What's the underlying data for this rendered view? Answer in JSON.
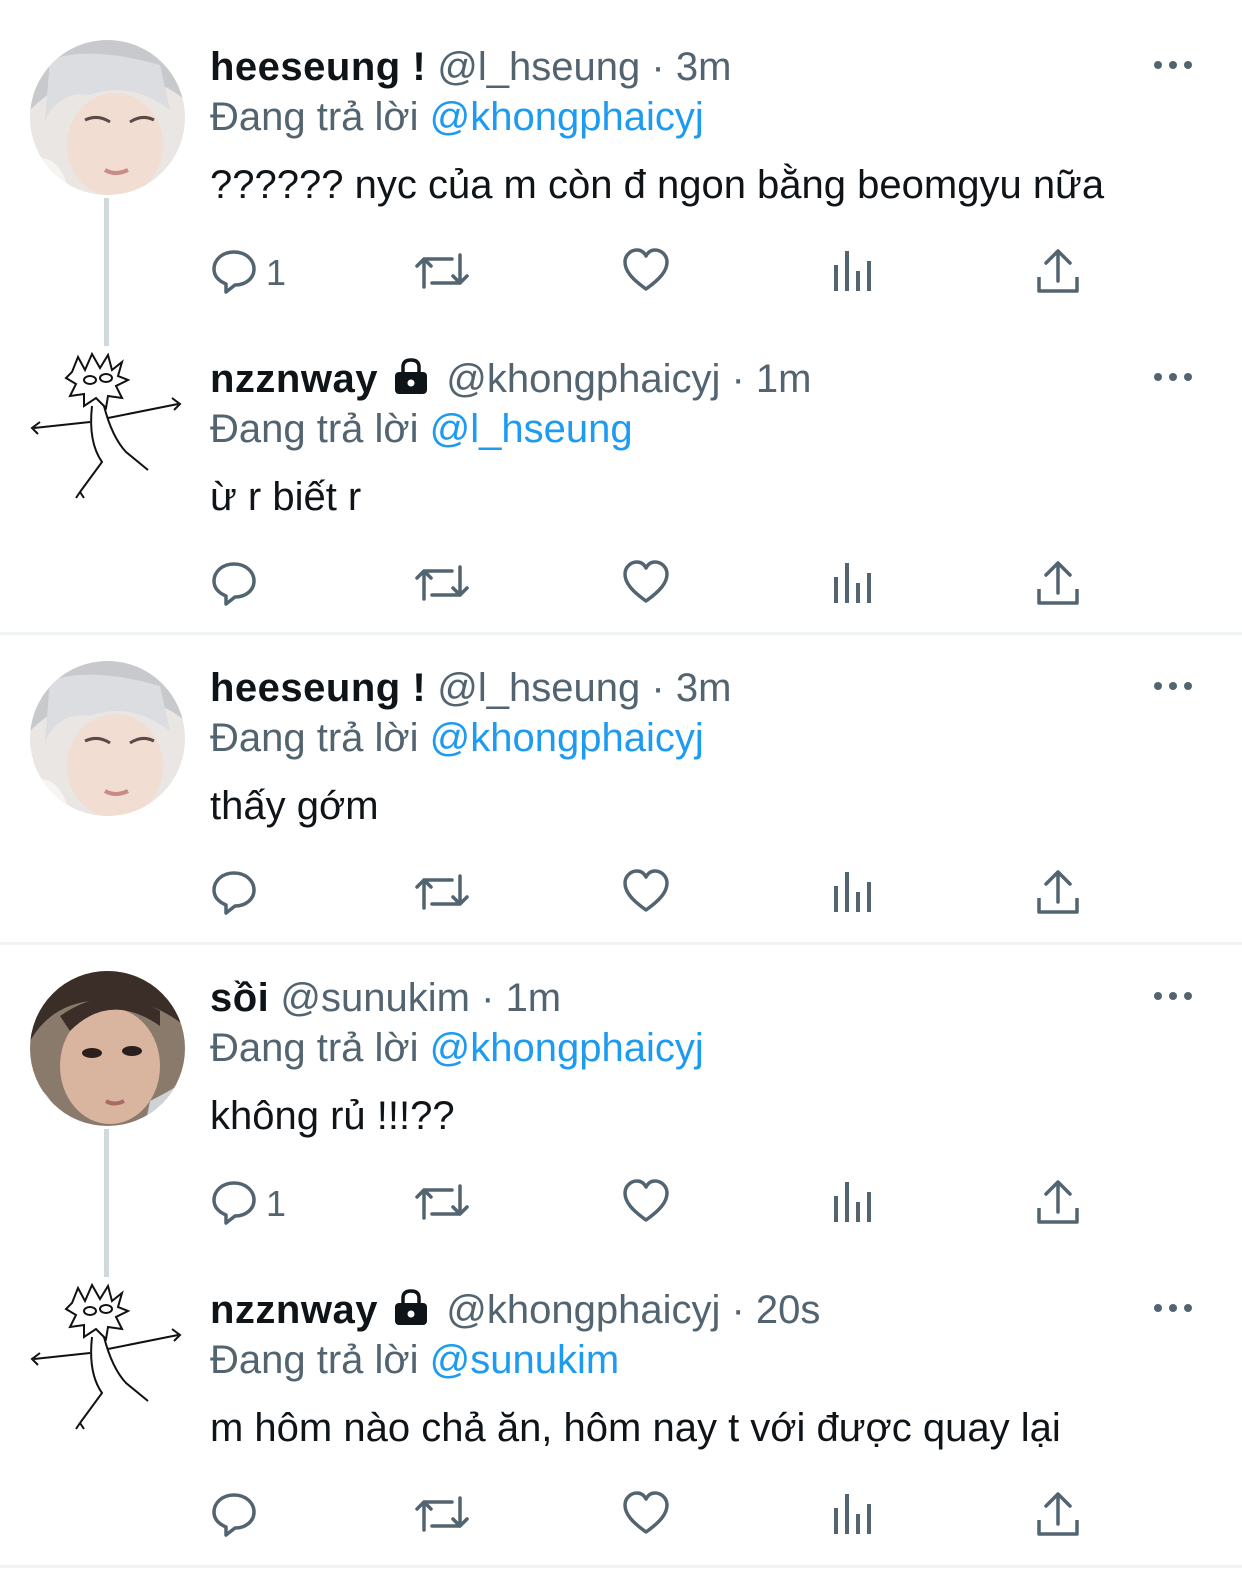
{
  "tweets": [
    {
      "name": "heeseung !",
      "handle": "@l_hseung",
      "dot": "·",
      "time": "3m",
      "locked": false,
      "reply_prefix": "Đang trả lời",
      "reply_to": "@khongphaicyj",
      "text": "?????? nyc của m còn đ ngon bằng beomgyu nữa",
      "reply_count": "1",
      "avatar": "photo-hair-grey"
    },
    {
      "name": "nzznway",
      "handle": "@khongphaicyj",
      "dot": "·",
      "time": "1m",
      "locked": true,
      "reply_prefix": "Đang trả lời",
      "reply_to": "@l_hseung",
      "text": "ừ r biết r",
      "reply_count": "",
      "avatar": "doodle"
    },
    {
      "name": "heeseung !",
      "handle": "@l_hseung",
      "dot": "·",
      "time": "3m",
      "locked": false,
      "reply_prefix": "Đang trả lời",
      "reply_to": "@khongphaicyj",
      "text": "thấy gớm",
      "reply_count": "",
      "avatar": "photo-hair-grey"
    },
    {
      "name": "sồi",
      "handle": "@sunukim",
      "dot": "·",
      "time": "1m",
      "locked": false,
      "reply_prefix": "Đang trả lời",
      "reply_to": "@khongphaicyj",
      "text": "không rủ !!!??",
      "reply_count": "1",
      "avatar": "photo-dark-hair"
    },
    {
      "name": "nzznway",
      "handle": "@khongphaicyj",
      "dot": "·",
      "time": "20s",
      "locked": true,
      "reply_prefix": "Đang trả lời",
      "reply_to": "@sunukim",
      "text": "m hôm nào chả ăn, hôm nay t với được quay lại",
      "reply_count": "",
      "avatar": "doodle"
    }
  ],
  "icons": [
    "reply-icon",
    "retweet-icon",
    "like-icon",
    "analytics-icon",
    "share-icon",
    "more-icon",
    "lock-icon"
  ],
  "colors": {
    "text": "#0f1419",
    "secondary": "#536471",
    "mention": "#1d9bf0",
    "thread_line": "#cfd9de",
    "separator": "#eff3f4"
  }
}
